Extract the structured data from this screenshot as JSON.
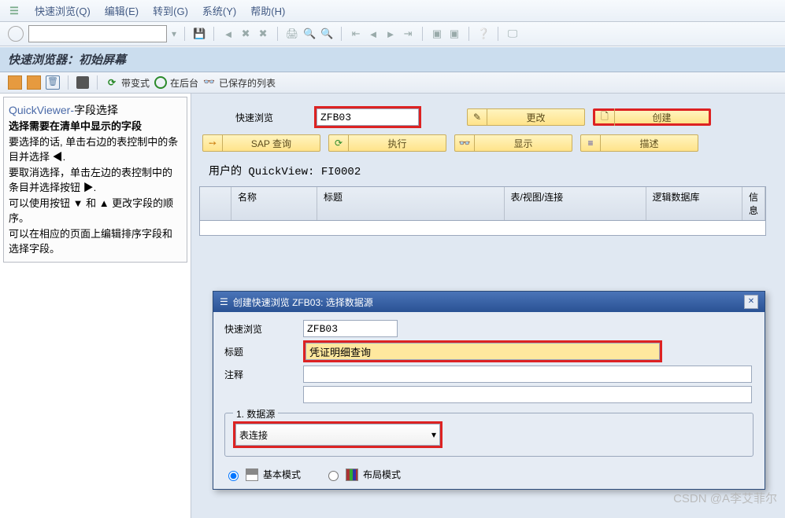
{
  "menu": {
    "quick": "快速浏览(Q)",
    "edit": "编辑(E)",
    "goto": "转到(G)",
    "system": "系统(Y)",
    "help": "帮助(H)"
  },
  "title": "快速浏览器：初始屏幕",
  "toolbar2": {
    "withvar": "带变式",
    "inback": "在后台",
    "saved": "已保存的列表"
  },
  "help": {
    "title_a": "QuickViewer-",
    "title_b": "字段选择",
    "l1": "选择需要在清单中显示的字段",
    "l2": "要选择的话, 单击右边的表控制中的条目并选择 ◀.",
    "l3": "要取消选择，单击左边的表控制中的条目并选择按钮 ▶.",
    "l4": "可以使用按钮 ▼ 和 ▲ 更改字段的顺序。",
    "l5": "可以在相应的页面上编辑排序字段和选择字段。"
  },
  "main": {
    "qv_label": "快速浏览",
    "qv_value": "ZFB03",
    "btn_change": "更改",
    "btn_create": "创建",
    "btn_sapq": "SAP 查询",
    "btn_exec": "执行",
    "btn_show": "显示",
    "btn_desc": "描述",
    "user_text": "用户的 QuickView: FI0002"
  },
  "table": {
    "c1": "名称",
    "c2": "标题",
    "c3": "表/视图/连接",
    "c4": "逻辑数据库",
    "c5": "信息"
  },
  "dialog": {
    "title": "创建快速浏览 ZFB03: 选择数据源",
    "qv_label": "快速浏览",
    "qv_value": "ZFB03",
    "tit_label": "标题",
    "tit_value": "凭证明细查询",
    "note_label": "注释",
    "ds_legend": "1. 数据源",
    "ds_value": "表连接",
    "mode_basic": "基本模式",
    "mode_layout": "布局模式"
  },
  "watermark": "CSDN @A李艾菲尔"
}
